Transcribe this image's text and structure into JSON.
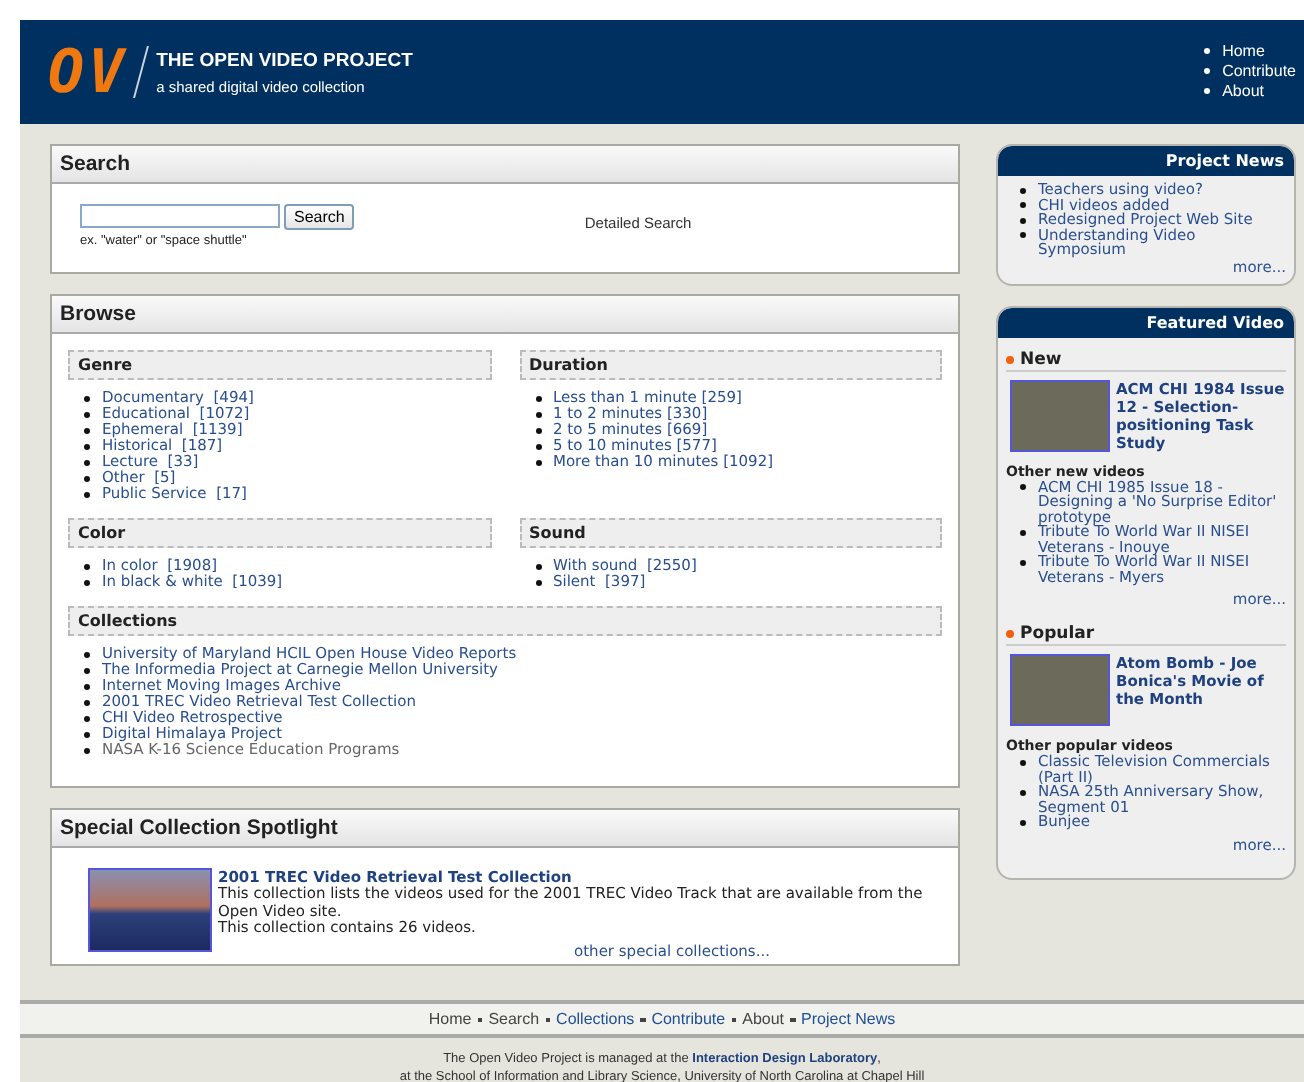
{
  "header": {
    "logo": "OV",
    "title": "THE OPEN VIDEO PROJECT",
    "subtitle": "a shared digital video collection",
    "nav": [
      "Home",
      "Contribute",
      "About"
    ]
  },
  "search": {
    "title": "Search",
    "button": "Search",
    "hint": "ex. \"water\" or \"space shuttle\"",
    "detailed": "Detailed Search"
  },
  "browse": {
    "title": "Browse",
    "groups": [
      {
        "title": "Genre",
        "items": [
          {
            "label": "Documentary  [494]",
            "visited": false
          },
          {
            "label": "Educational  [1072]",
            "visited": false
          },
          {
            "label": "Ephemeral  [1139]",
            "visited": false
          },
          {
            "label": "Historical  [187]",
            "visited": false
          },
          {
            "label": "Lecture  [33]",
            "visited": false
          },
          {
            "label": "Other  [5]",
            "visited": false
          },
          {
            "label": "Public Service  [17]",
            "visited": false
          }
        ]
      },
      {
        "title": "Duration",
        "items": [
          {
            "label": "Less than 1 minute [259]",
            "visited": false
          },
          {
            "label": "1 to 2 minutes [330]",
            "visited": false
          },
          {
            "label": "2 to 5 minutes [669]",
            "visited": false
          },
          {
            "label": "5 to 10 minutes [577]",
            "visited": false
          },
          {
            "label": "More than 10 minutes [1092]",
            "visited": false
          }
        ]
      },
      {
        "title": "Color",
        "items": [
          {
            "label": "In color  [1908]",
            "visited": false
          },
          {
            "label": "In black & white  [1039]",
            "visited": false
          }
        ]
      },
      {
        "title": "Sound",
        "items": [
          {
            "label": "With sound  [2550]",
            "visited": false
          },
          {
            "label": "Silent  [397]",
            "visited": false
          }
        ]
      }
    ],
    "collections": {
      "title": "Collections",
      "items": [
        {
          "label": "University of Maryland HCIL Open House Video Reports",
          "visited": false
        },
        {
          "label": "The Informedia Project at Carnegie Mellon University",
          "visited": false
        },
        {
          "label": "Internet Moving Images Archive",
          "visited": false
        },
        {
          "label": "2001 TREC Video Retrieval Test Collection",
          "visited": false
        },
        {
          "label": "CHI Video Retrospective",
          "visited": false
        },
        {
          "label": "Digital Himalaya Project",
          "visited": false
        },
        {
          "label": "NASA K-16 Science Education Programs",
          "visited": true
        }
      ]
    }
  },
  "spotlight": {
    "title": "Special Collection Spotlight",
    "item_title": "2001 TREC Video Retrieval Test Collection",
    "description": "This collection lists the videos used for the 2001 TREC Video Track that are available from the Open Video site.",
    "count": "This collection contains 26 videos.",
    "more": "other special collections..."
  },
  "news": {
    "title": "Project News",
    "items": [
      "Teachers using video?",
      "CHI videos added",
      "Redesigned Project Web Site",
      "Understanding Video Symposium"
    ],
    "more": "more..."
  },
  "featured": {
    "title": "Featured Video",
    "sections": [
      {
        "title": "New",
        "video": "ACM CHI 1984 Issue 12 - Selection-positioning Task Study",
        "other_label": "Other new videos",
        "items": [
          "ACM CHI 1985 Issue 18 - Designing a 'No Surprise Editor' prototype",
          "Tribute To World War II NISEI Veterans - Inouye",
          "Tribute To World War II NISEI Veterans - Myers"
        ],
        "more": "more..."
      },
      {
        "title": "Popular",
        "video": "Atom Bomb - Joe Bonica's Movie of the Month",
        "other_label": "Other popular videos",
        "items": [
          "Classic Television Commercials (Part II)",
          "NASA 25th Anniversary Show, Segment 01",
          "Bunjee"
        ],
        "more": "more..."
      }
    ]
  },
  "footer": {
    "nav": [
      {
        "label": "Home",
        "visited": true
      },
      {
        "label": "Search",
        "visited": true
      },
      {
        "label": "Collections",
        "visited": false
      },
      {
        "label": "Contribute",
        "visited": false
      },
      {
        "label": "About",
        "visited": true
      },
      {
        "label": "Project News",
        "visited": false
      }
    ],
    "text_before": "The Open Video Project is managed at the",
    "lab": "Interaction Design Laboratory",
    "text_after": ",",
    "line2": "at the School of Information and Library Science, University of North Carolina at Chapel Hill"
  }
}
